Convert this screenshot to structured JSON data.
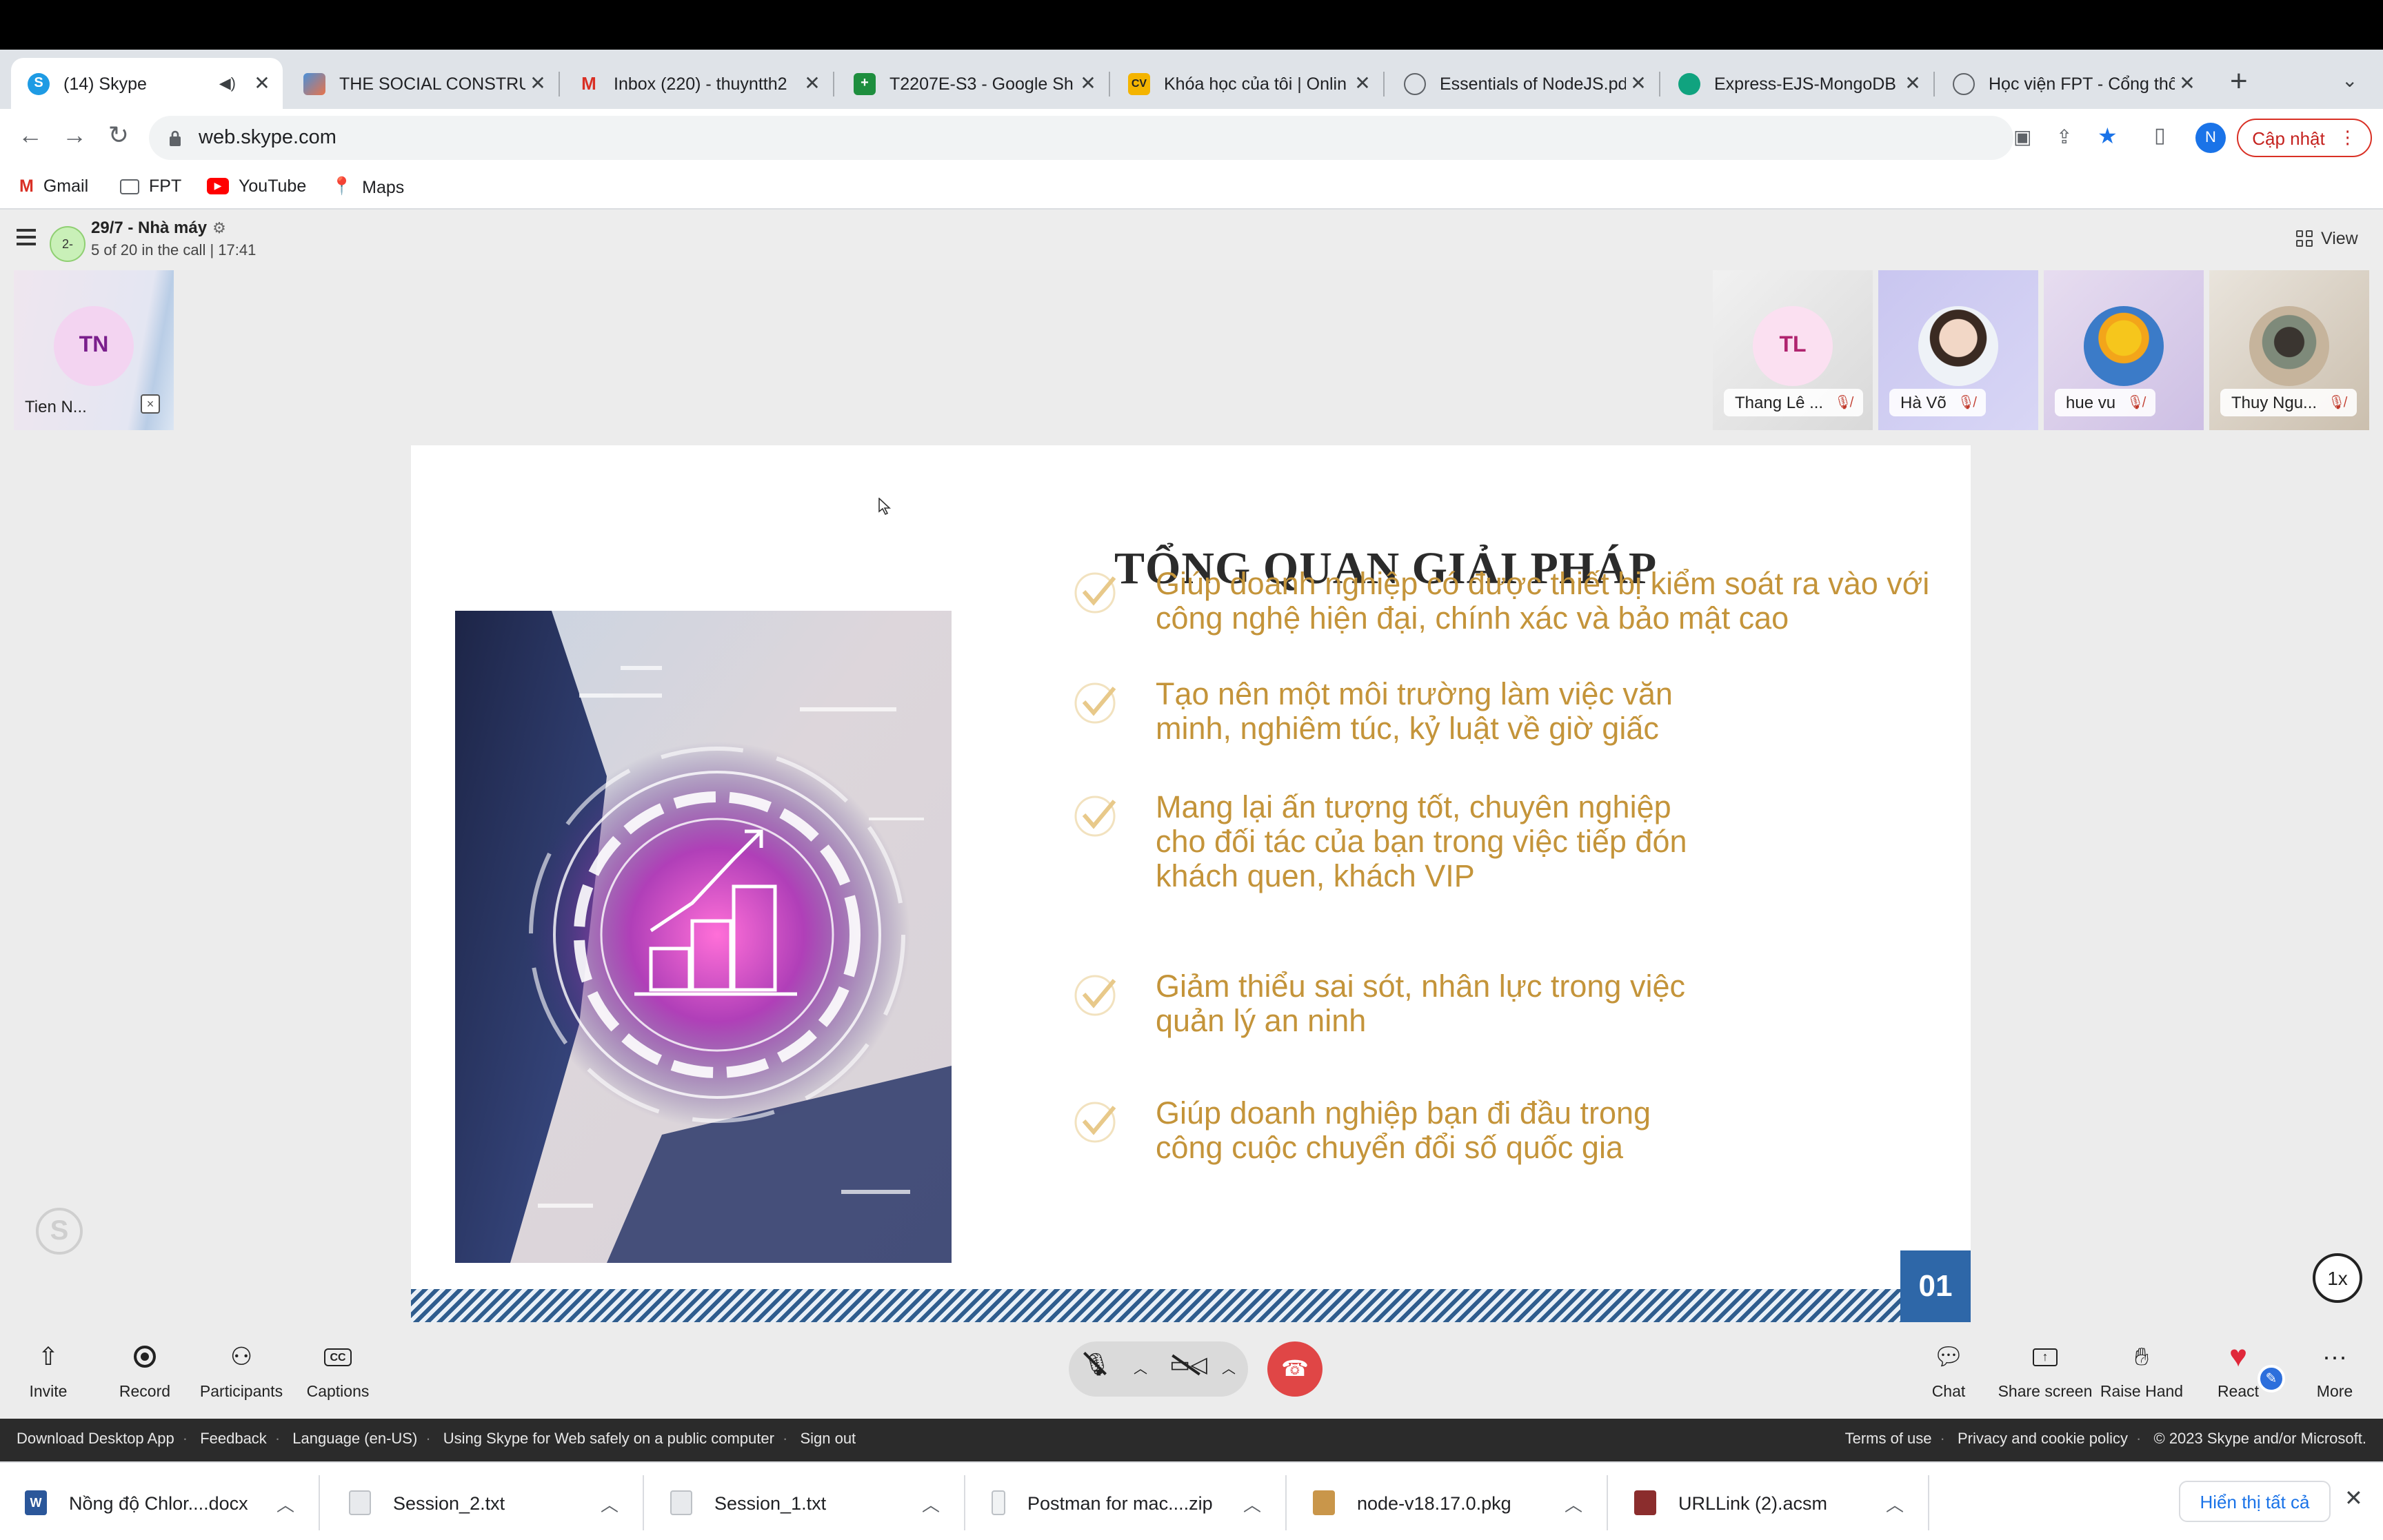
{
  "browser": {
    "tabs": [
      {
        "title": "(14) Skype",
        "favicon": "skype-icon",
        "active": true
      },
      {
        "title": "THE SOCIAL CONSTRUC",
        "favicon": "layers-icon"
      },
      {
        "title": "Inbox (220) - thuyntth2",
        "favicon": "gmail-icon"
      },
      {
        "title": "T2207E-S3 - Google Sh",
        "favicon": "sheets-icon"
      },
      {
        "title": "Khóa học của tôi | Onlin",
        "favicon": "cv-icon"
      },
      {
        "title": "Essentials of NodeJS.pd",
        "favicon": "globe-icon"
      },
      {
        "title": "Express-EJS-MongoDB",
        "favicon": "chatgpt-icon"
      },
      {
        "title": "Học viện FPT - Cổng thô",
        "favicon": "globe-icon"
      }
    ],
    "url": "web.skype.com",
    "profile_initial": "N",
    "update_label": "Cập nhật",
    "bookmarks": [
      {
        "label": "Gmail",
        "icon": "gmail-icon"
      },
      {
        "label": "FPT",
        "icon": "folder-icon"
      },
      {
        "label": "YouTube",
        "icon": "youtube-icon"
      },
      {
        "label": "Maps",
        "icon": "maps-icon"
      }
    ]
  },
  "call": {
    "group_avatar": "2-",
    "title": "29/7 - Nhà máy",
    "subtitle": "5 of 20 in the call | 17:41",
    "view_label": "View",
    "participants": [
      {
        "name": "Tien N...",
        "initials": "TN"
      },
      {
        "name": "Thang Lê ...",
        "initials": "TL"
      },
      {
        "name": "Hà Võ",
        "initials": ""
      },
      {
        "name": "hue vu",
        "initials": ""
      },
      {
        "name": "Thuy Ngu...",
        "initials": ""
      }
    ],
    "speed_label": "1x"
  },
  "slide": {
    "title": "TỔNG QUAN GIẢI PHÁP",
    "bullets": [
      [
        "Giúp doanh nghiệp có được thiết bị  kiểm soát ra vào với",
        "công nghệ hiện đại, chính xác và bảo mật cao"
      ],
      [
        "Tạo nên một môi trường làm việc văn",
        "minh, nghiêm túc, kỷ luật về giờ giấc"
      ],
      [
        "Mang lại ấn tượng tốt, chuyên nghiệp",
        "cho đối tác của bạn trong việc tiếp đón",
        "khách quen, khách VIP"
      ],
      [
        "Giảm thiểu sai sót, nhân lực trong việc",
        "quản lý an ninh"
      ],
      [
        "Giúp doanh nghiệp bạn đi đầu trong",
        "công cuộc chuyển đổi số quốc gia"
      ]
    ],
    "page_number": "01",
    "bullet_color": "#c4943a"
  },
  "controls": {
    "left": [
      {
        "label": "Invite",
        "icon": "share-icon"
      },
      {
        "label": "Record",
        "icon": "record-icon"
      },
      {
        "label": "Participants",
        "icon": "participants-icon"
      },
      {
        "label": "Captions",
        "icon": "captions-icon"
      }
    ],
    "right": [
      {
        "label": "Chat",
        "icon": "chat-icon"
      },
      {
        "label": "Share screen",
        "icon": "share-screen-icon"
      },
      {
        "label": "Raise Hand",
        "icon": "hand-icon"
      },
      {
        "label": "React",
        "icon": "heart-icon"
      },
      {
        "label": "More",
        "icon": "more-icon"
      }
    ]
  },
  "footer": {
    "left": [
      "Download Desktop App",
      "Feedback",
      "Language (en-US)",
      "Using Skype for Web safely on a public computer",
      "Sign out"
    ],
    "right": [
      "Terms of use",
      "Privacy and cookie policy",
      "© 2023 Skype and/or Microsoft."
    ]
  },
  "downloads": {
    "items": [
      {
        "name": "Nồng độ Chlor....docx",
        "icon": "word-icon"
      },
      {
        "name": "Session_2.txt",
        "icon": "file-icon"
      },
      {
        "name": "Session_1.txt",
        "icon": "file-icon"
      },
      {
        "name": "Postman for mac....zip",
        "icon": "zip-icon"
      },
      {
        "name": "node-v18.17.0.pkg",
        "icon": "package-icon"
      },
      {
        "name": "URLLink (2).acsm",
        "icon": "document-icon"
      }
    ],
    "show_all": "Hiển thị tất cả"
  }
}
